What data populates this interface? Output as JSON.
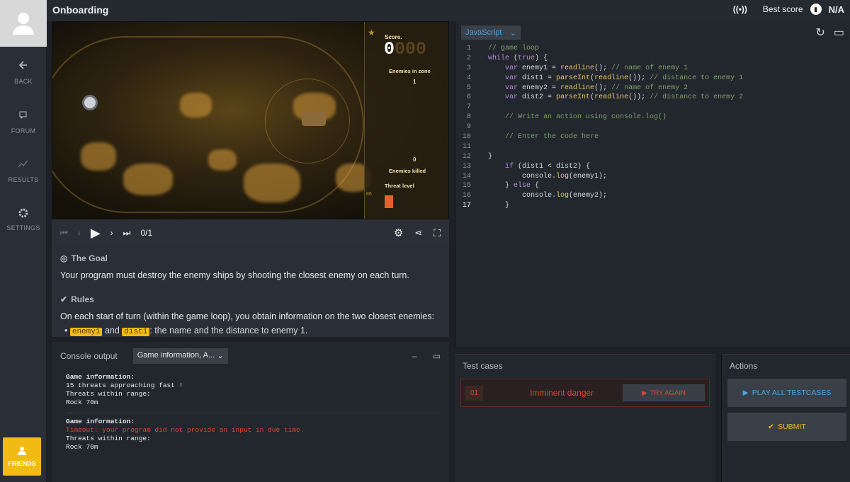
{
  "nav": {
    "back": "BACK",
    "forum": "FORUM",
    "results": "RESULTS",
    "settings": "SETTINGS",
    "friends": "FRIENDS"
  },
  "header": {
    "title": "Onboarding",
    "best_score_label": "Best score",
    "best_score_value": "N/A"
  },
  "viewer": {
    "score_label": "Score.",
    "score_value": "0",
    "score_ghost": "000",
    "enemies_in_zone_label": "Enemies in zone",
    "enemies_in_zone_value": "1",
    "enemies_killed_label": "Enemies killed",
    "enemies_killed_value": "0",
    "threat_level_label": "Threat level",
    "threat_level_value": "86",
    "frame": "0/1"
  },
  "statement": {
    "goal_title": "The Goal",
    "goal_text": "Your program must destroy the enemy ships by shooting the closest enemy on each turn.",
    "rules_title": "Rules",
    "rules_text": "On each start of turn (within the game loop), you obtain information on the two closest enemies:",
    "bullet_tag1": "enemy1",
    "bullet_and": "and",
    "bullet_tag2": "dist1",
    "bullet_rest": ": the name and the distance to enemy 1."
  },
  "console": {
    "title": "Console output",
    "filter": "Game information, A...",
    "blocks": [
      {
        "head": "Game information:",
        "lines": [
          "15 threats approaching fast !",
          "Threats within range:",
          "Rock 70m"
        ],
        "error": ""
      },
      {
        "head": "Game information:",
        "lines": [
          "Threats within range:",
          "Rock 70m"
        ],
        "error": "Timeout: your program did not provide an input in due time."
      }
    ]
  },
  "editor": {
    "language": "JavaScript",
    "lines": [
      "// game loop",
      "while (true) {",
      "    var enemy1 = readline(); // name of enemy 1",
      "    var dist1 = parseInt(readline()); // distance to enemy 1",
      "    var enemy2 = readline(); // name of enemy 2",
      "    var dist2 = parseInt(readline()); // distance to enemy 2",
      "",
      "    // Write an action using console.log()",
      "",
      "    // Enter the code here",
      "",
      "}",
      "    if (dist1 < dist2) {",
      "        console.log(enemy1);",
      "    } else {",
      "        console.log(enemy2);",
      "    }"
    ]
  },
  "tests": {
    "title": "Test cases",
    "items": [
      {
        "num": "01",
        "name": "Imminent danger",
        "action": "TRY AGAIN"
      }
    ]
  },
  "actions": {
    "title": "Actions",
    "play_all": "PLAY ALL TESTCASES",
    "submit": "SUBMIT"
  },
  "colors": {
    "accent": "#f2bb13",
    "link": "#4aa3df",
    "error": "#d7473a"
  }
}
